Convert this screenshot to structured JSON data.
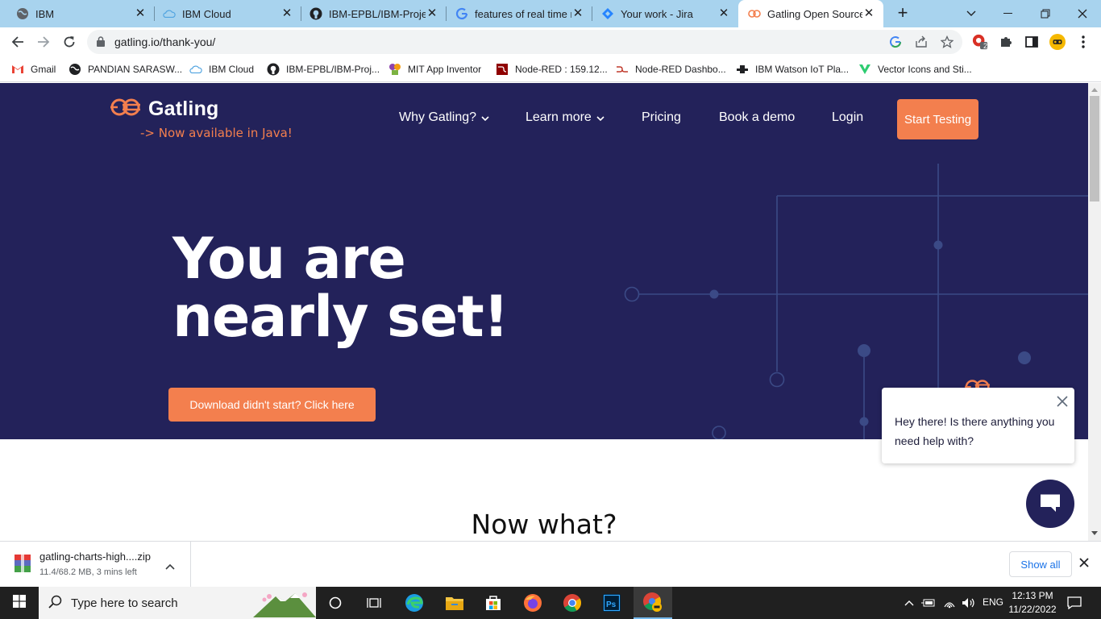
{
  "tabs": [
    {
      "label": "IBM",
      "icon": "globe-icon"
    },
    {
      "label": "IBM Cloud",
      "icon": "cloud-icon"
    },
    {
      "label": "IBM-EPBL/IBM-Project",
      "icon": "github-icon"
    },
    {
      "label": "features of real time n",
      "icon": "google-icon"
    },
    {
      "label": "Your work - Jira",
      "icon": "jira-icon"
    },
    {
      "label": "Gatling Open Source T",
      "icon": "gatling-icon"
    }
  ],
  "toolbar": {
    "url": "gatling.io/thank-you/"
  },
  "bookmarks": [
    {
      "label": "Gmail"
    },
    {
      "label": "PANDIAN SARASW..."
    },
    {
      "label": "IBM Cloud"
    },
    {
      "label": "IBM-EPBL/IBM-Proj..."
    },
    {
      "label": "MIT App Inventor"
    },
    {
      "label": "Node-RED : 159.12..."
    },
    {
      "label": "Node-RED Dashbo..."
    },
    {
      "label": "IBM Watson IoT Pla..."
    },
    {
      "label": "Vector Icons and Sti..."
    }
  ],
  "extension_badge": "2",
  "page": {
    "logo_text": "Gatling",
    "tagline": "-> Now available in Java!",
    "nav": {
      "why": "Why Gatling?",
      "learn": "Learn more",
      "pricing": "Pricing",
      "demo": "Book a demo",
      "login": "Login",
      "cta": "Start Testing"
    },
    "hero_line1": "You are",
    "hero_line2": "nearly set!",
    "download_button": "Download didn't start? Click here",
    "section_title": "Now what?",
    "chat_message": "Hey there! Is there anything you need help with?"
  },
  "download": {
    "filename": "gatling-charts-high....zip",
    "status": "11.4/68.2 MB, 3 mins left",
    "show_all": "Show all"
  },
  "taskbar": {
    "search_placeholder": "Type here to search",
    "language": "ENG",
    "time": "12:13 PM",
    "date": "11/22/2022"
  },
  "colors": {
    "tab_strip": "#a8d3ee",
    "hero_bg": "#23225a",
    "accent_orange": "#f37f4e",
    "circuit_line": "#3b4a86"
  }
}
